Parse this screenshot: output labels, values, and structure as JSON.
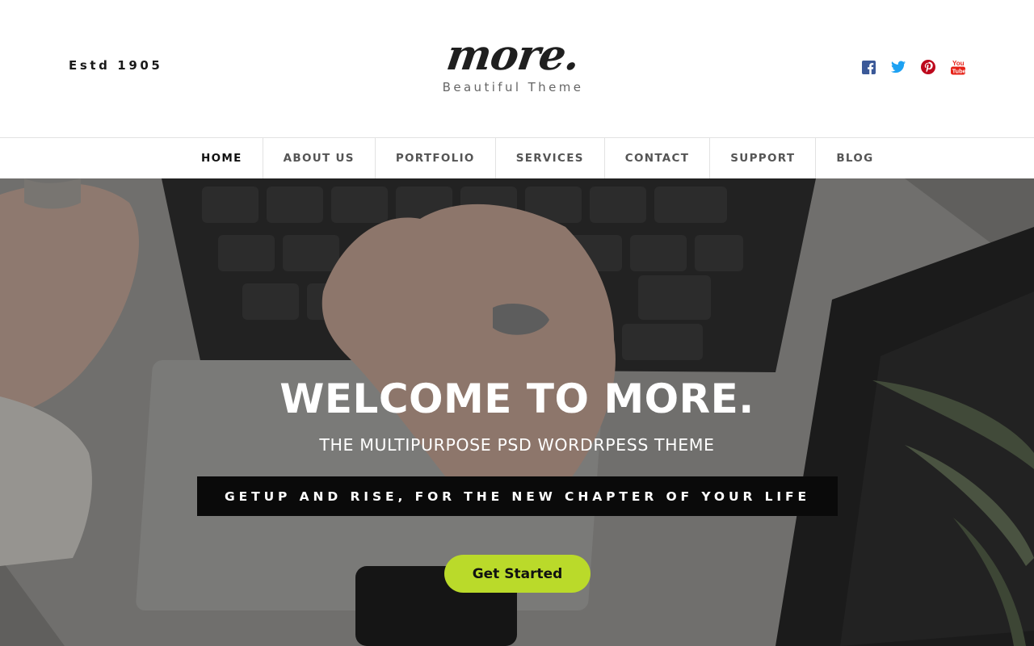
{
  "header": {
    "estd": "Estd 1905",
    "logo": {
      "word": "more.",
      "tagline": "Beautiful Theme"
    },
    "socials": [
      {
        "icon": "facebook-icon",
        "color": "#3b5998"
      },
      {
        "icon": "twitter-icon",
        "color": "#1da1f2"
      },
      {
        "icon": "pinterest-icon",
        "color": "#bd081c"
      },
      {
        "icon": "youtube-icon",
        "color": "#e62117"
      }
    ]
  },
  "nav": {
    "items": [
      {
        "label": "HOME",
        "active": true
      },
      {
        "label": "ABOUT US",
        "active": false
      },
      {
        "label": "PORTFOLIO",
        "active": false
      },
      {
        "label": "SERVICES",
        "active": false
      },
      {
        "label": "CONTACT",
        "active": false
      },
      {
        "label": "SUPPORT",
        "active": false
      },
      {
        "label": "BLOG",
        "active": false
      }
    ]
  },
  "hero": {
    "title": "WELCOME TO MORE.",
    "subtitle": "THE MULTIPURPOSE PSD WORDRPESS THEME",
    "banner": "GETUP AND RISE, FOR THE NEW CHAPTER OF YOUR LIFE",
    "cta": "Get Started"
  },
  "colors": {
    "accent": "#bada2a",
    "banner_bg": "#0a0a0a",
    "nav_active": "#111111",
    "nav_text": "#555555"
  }
}
